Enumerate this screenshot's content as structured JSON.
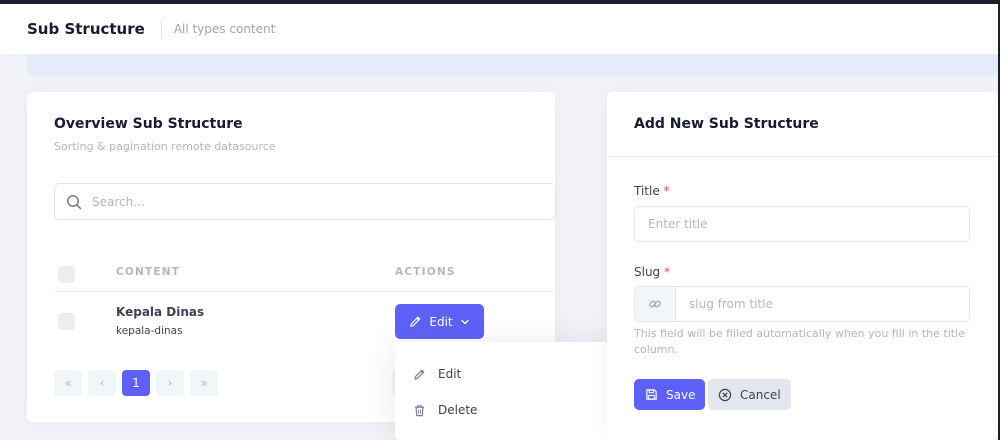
{
  "header": {
    "title": "Sub Structure",
    "description": "All types content"
  },
  "overview": {
    "title": "Overview Sub Structure",
    "subtitle": "Sorting & pagination remote datasource",
    "search_placeholder": "Search...",
    "columns": [
      "CONTENT",
      "ACTIONS"
    ],
    "rows": [
      {
        "name": "Kepala Dinas",
        "slug": "kepala-dinas",
        "action_label": "Edit"
      }
    ],
    "pagination": {
      "first": "«",
      "prev": "‹",
      "current": "1",
      "next": "›",
      "last": "»"
    },
    "dropdown": {
      "items": [
        {
          "label": "Edit",
          "icon": "pencil-icon"
        },
        {
          "label": "Delete",
          "icon": "trash-icon"
        }
      ]
    }
  },
  "form": {
    "title": "Add New Sub Structure",
    "title_label": "Title",
    "title_placeholder": "Enter title",
    "slug_label": "Slug",
    "slug_placeholder": "slug from title",
    "required_mark": "*",
    "help_text": "This field will be filled automatically when you fill in the title column.",
    "save_label": "Save",
    "cancel_label": "Cancel"
  },
  "colors": {
    "primary": "#5d61f7",
    "danger": "#f64e60",
    "muted": "#b5b5c3"
  }
}
